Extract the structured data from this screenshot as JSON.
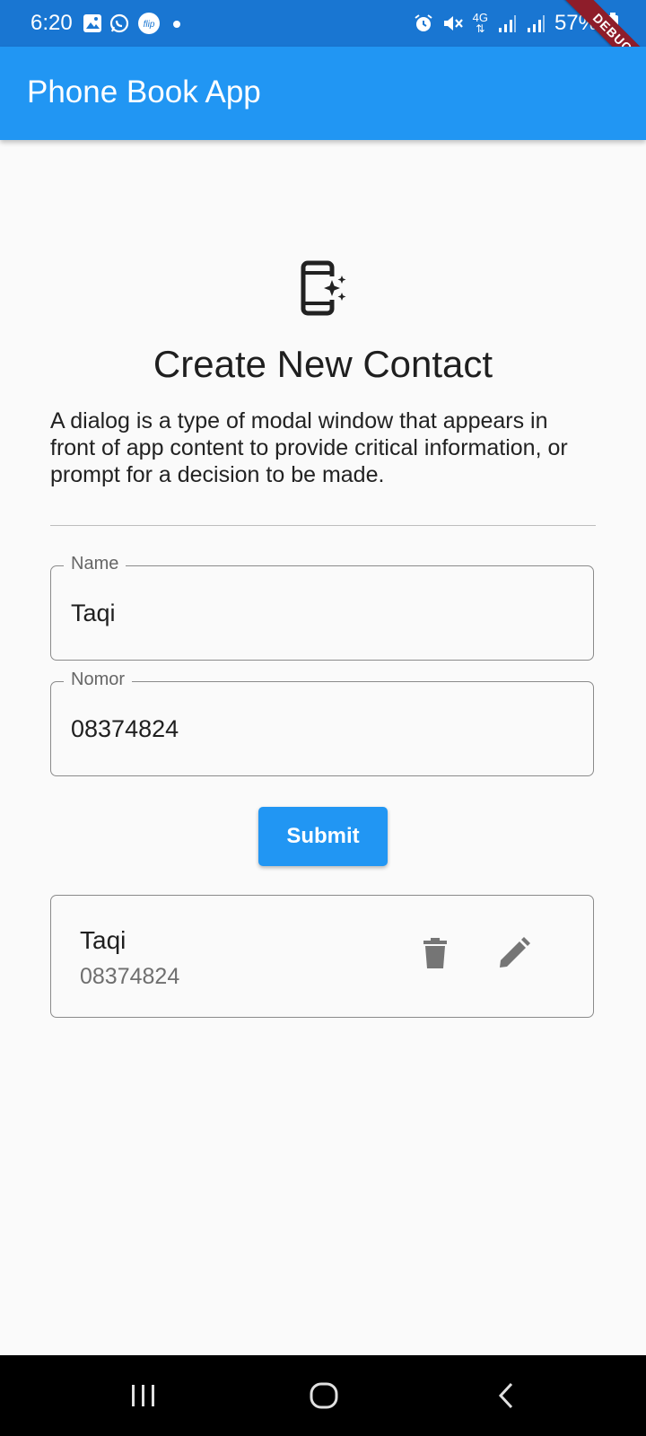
{
  "status_bar": {
    "time": "6:20",
    "battery": "57%",
    "network": "4G",
    "notification_icons": [
      "gallery-icon",
      "whatsapp-icon",
      "flip-icon",
      "dot-icon"
    ],
    "system_icons": [
      "alarm-icon",
      "mute-icon",
      "4g-icon",
      "signal-icon",
      "signal-icon",
      "battery-icon"
    ]
  },
  "debug_banner": "DEBUG",
  "app_bar": {
    "title": "Phone Book App"
  },
  "form_header": {
    "icon": "phone-sparkle-icon",
    "title": "Create New Contact",
    "description": "A dialog is a type of modal window that appears in front of app content to provide critical information, or prompt for a decision to be made."
  },
  "form": {
    "name_label": "Name",
    "name_value": "Taqi",
    "number_label": "Nomor",
    "number_value": "08374824",
    "submit_label": "Submit"
  },
  "contacts": [
    {
      "name": "Taqi",
      "number": "08374824"
    }
  ],
  "colors": {
    "status_bar": "#1976d2",
    "app_bar": "#2196f3",
    "button": "#2196f3",
    "debug_ribbon": "#8e1d2a",
    "background": "#fafafa"
  }
}
